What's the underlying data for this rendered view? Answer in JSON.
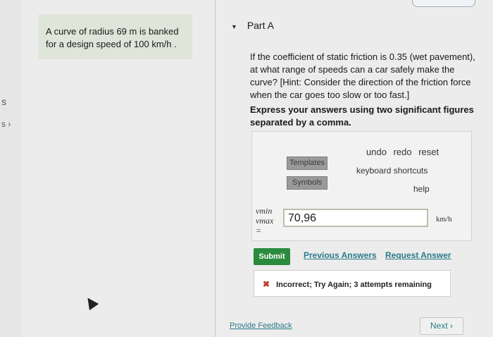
{
  "edge": {
    "s1": "s",
    "s2": "s ›"
  },
  "problem": {
    "line1": "A curve of radius 69 m is banked",
    "line2": "for a design speed of 100 km/h ."
  },
  "part": {
    "title": "Part A",
    "arrow": "▼"
  },
  "question": {
    "line1": "If the coefficient of static friction is 0.35 (wet pavement),",
    "line2": "at what range of speeds can a car safely make the",
    "line3": "curve? [Hint: Consider the direction of the friction force",
    "line4": "when the car goes too slow or too fast.]"
  },
  "instructions": {
    "line1": "Express your answers using two significant figures",
    "line2": "separated by a comma."
  },
  "toolbar": {
    "templates": "Templates",
    "symbols": "Symbols",
    "undo": "undo",
    "redo": "redo",
    "reset": "reset",
    "keyboard": "keyboard shortcuts",
    "help": "help"
  },
  "answer": {
    "var_min": "vmin",
    "var_max": "vmax",
    "equals": "=",
    "value": "70,96",
    "unit": "km/h"
  },
  "actions": {
    "submit": "Submit",
    "previous": "Previous Answers",
    "request": "Request Answer"
  },
  "result": {
    "icon": "✖",
    "text": "Incorrect; Try Again; 3 attempts remaining"
  },
  "footer": {
    "feedback": "Provide Feedback",
    "next": "Next ›"
  },
  "colors": {
    "submit_green": "#2a8a3e",
    "link_teal": "#2a7a8a",
    "error_red": "#c0392b",
    "problem_bg": "#dfe5d9"
  }
}
